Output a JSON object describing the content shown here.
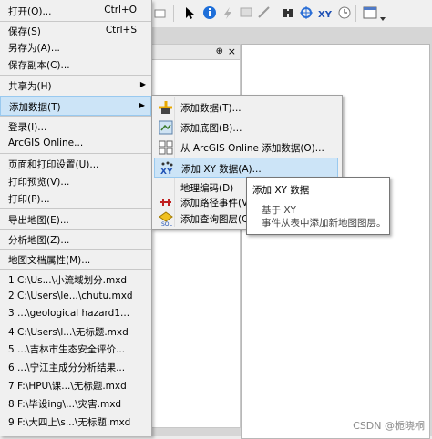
{
  "menu": {
    "items": [
      {
        "label": "打开(O)...",
        "shortcut": "Ctrl+O"
      },
      {
        "label": "保存(S)",
        "shortcut": "Ctrl+S"
      },
      {
        "label": "另存为(A)..."
      },
      {
        "label": "保存副本(C)..."
      },
      {
        "label": "共享为(H)",
        "submenu": true
      },
      {
        "label": "添加数据(T)",
        "submenu": true,
        "highlighted": true
      },
      {
        "label": "登录(I)..."
      },
      {
        "label": "ArcGIS Online..."
      },
      {
        "label": "页面和打印设置(U)..."
      },
      {
        "label": "打印预览(V)..."
      },
      {
        "label": "打印(P)..."
      },
      {
        "label": "导出地图(E)..."
      },
      {
        "label": "分析地图(Z)..."
      },
      {
        "label": "地图文档属性(M)..."
      },
      {
        "label": "1 C:\\Us...\\小流域划分.mxd"
      },
      {
        "label": "2 C:\\Users\\le...\\chutu.mxd"
      },
      {
        "label": "3 ...\\geological hazard1..."
      },
      {
        "label": "4 C:\\Users\\l...\\无标题.mxd"
      },
      {
        "label": "5 ...\\吉林市生态安全评价..."
      },
      {
        "label": "6 ...\\宁江主成分分析结果..."
      },
      {
        "label": "7 F:\\HPU\\课...\\无标题.mxd"
      },
      {
        "label": "8 F:\\毕设ing\\...\\灾害.mxd"
      },
      {
        "label": "9 F:\\大四上\\s...\\无标题.mxd"
      }
    ]
  },
  "submenu": {
    "items": [
      {
        "label": "添加数据(T)...",
        "icon": "add-data-icon"
      },
      {
        "label": "添加底图(B)...",
        "icon": "basemap-icon"
      },
      {
        "label": "从 ArcGIS Online 添加数据(O)...",
        "icon": "arcgis-online-icon"
      },
      {
        "label": "添加 XY 数据(A)...",
        "icon": "xy-data-icon",
        "highlighted": true
      },
      {
        "label": "地理编码(D)",
        "icon": "geocode-icon"
      },
      {
        "label": "添加路径事件(V)...",
        "icon": "route-event-icon"
      },
      {
        "label": "添加查询图层(Q)...",
        "icon": "query-layer-icon"
      }
    ]
  },
  "tooltip": {
    "title": "添加 XY 数据",
    "line1": "基于 XY",
    "line2": "事件从表中添加新地图图层。"
  },
  "toc": {
    "pin": "⊕",
    "close": "×"
  },
  "watermark": "CSDN @栀晓桐",
  "colors": {
    "highlight": "#cce4f7",
    "highlight_border": "#99c9ef",
    "menu_bg": "#f0f0f0"
  }
}
